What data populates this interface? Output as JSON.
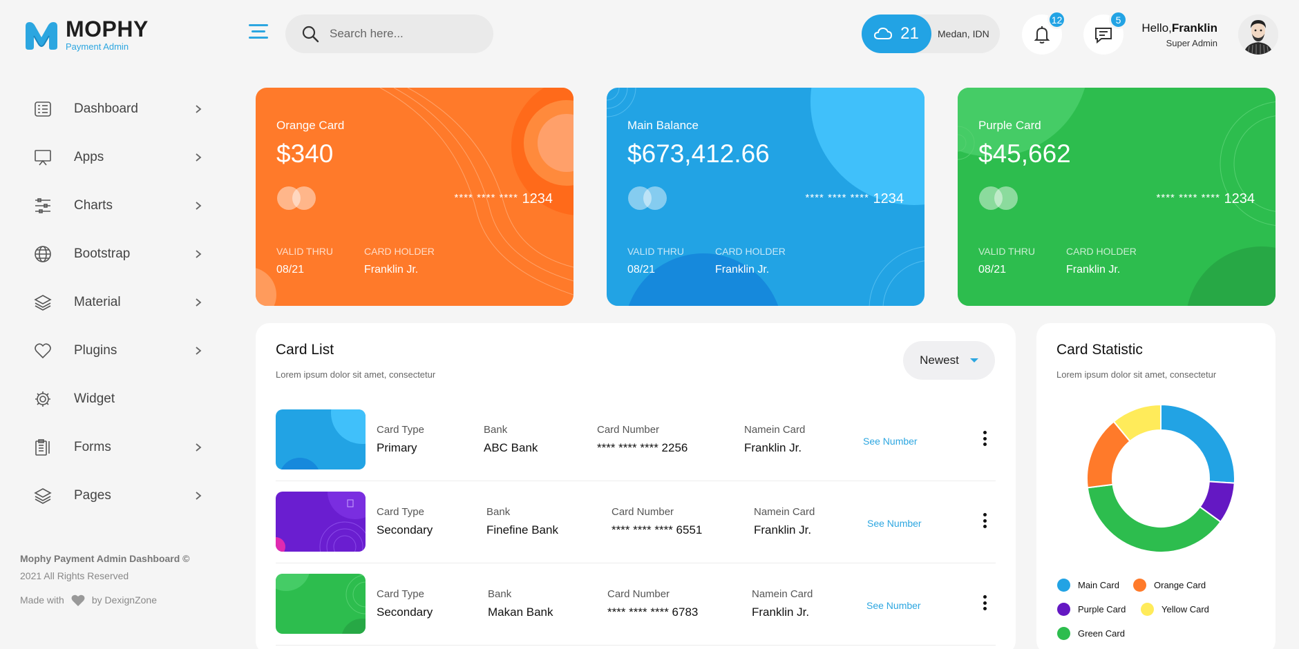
{
  "brand": {
    "title": "MOPHY",
    "subtitle": "Payment Admin",
    "accent": "#2ca6e0"
  },
  "sidebar": {
    "items": [
      {
        "label": "Dashboard",
        "icon": "dashboard-icon",
        "has_chevron": true
      },
      {
        "label": "Apps",
        "icon": "apps-icon",
        "has_chevron": true
      },
      {
        "label": "Charts",
        "icon": "charts-icon",
        "has_chevron": true
      },
      {
        "label": "Bootstrap",
        "icon": "globe-icon",
        "has_chevron": true
      },
      {
        "label": "Material",
        "icon": "layers-icon",
        "has_chevron": true
      },
      {
        "label": "Plugins",
        "icon": "heart-icon",
        "has_chevron": true
      },
      {
        "label": "Widget",
        "icon": "gear-icon",
        "has_chevron": false
      },
      {
        "label": "Forms",
        "icon": "forms-icon",
        "has_chevron": true
      },
      {
        "label": "Pages",
        "icon": "pages-icon",
        "has_chevron": true
      }
    ],
    "footer": {
      "copyright": "Mophy Payment Admin Dashboard ©",
      "rights": "2021 All Rights Reserved",
      "made_with": "Made with",
      "by": "by DexignZone"
    }
  },
  "header": {
    "search_placeholder": "Search here...",
    "weather": {
      "temp": "21",
      "location": "Medan, IDN"
    },
    "notifications_count": "12",
    "messages_count": "5",
    "user": {
      "greeting": "Hello,",
      "name": "Franklin",
      "role": "Super Admin"
    }
  },
  "cards": [
    {
      "label": "Orange Card",
      "amount": "$340",
      "stars": "**** **** ****",
      "last4": "1234",
      "valid_label": "VALID THRU",
      "valid": "08/21",
      "holder_label": "CARD HOLDER",
      "holder": "Franklin Jr.",
      "color": "#ff7a2a"
    },
    {
      "label": "Main Balance",
      "amount": "$673,412.66",
      "stars": "**** **** ****",
      "last4": "1234",
      "valid_label": "VALID THRU",
      "valid": "08/21",
      "holder_label": "CARD HOLDER",
      "holder": "Franklin Jr.",
      "color": "#22a3e4"
    },
    {
      "label": "Purple Card",
      "amount": "$45,662",
      "stars": "**** **** ****",
      "last4": "1234",
      "valid_label": "VALID THRU",
      "valid": "08/21",
      "holder_label": "CARD HOLDER",
      "holder": "Franklin Jr.",
      "color": "#2dbd4e"
    }
  ],
  "card_list": {
    "title": "Card List",
    "subtitle": "Lorem ipsum dolor sit amet, consectetur",
    "sort": "Newest",
    "column_labels": {
      "type": "Card Type",
      "bank": "Bank",
      "number": "Card Number",
      "name": "Namein Card"
    },
    "see_label": "See Number",
    "rows": [
      {
        "type": "Primary",
        "bank": "ABC Bank",
        "number": "**** **** **** 2256",
        "name": "Franklin Jr.",
        "color": "#22a3e4"
      },
      {
        "type": "Secondary",
        "bank": "Finefine Bank",
        "number": "**** **** **** 6551",
        "name": "Franklin Jr.",
        "color": "#6a1ed0"
      },
      {
        "type": "Secondary",
        "bank": "Makan Bank",
        "number": "**** **** **** 6783",
        "name": "Franklin Jr.",
        "color": "#2dbd4e"
      }
    ]
  },
  "statistic": {
    "title": "Card Statistic",
    "subtitle": "Lorem ipsum dolor sit amet, consectetur",
    "chart_data": {
      "type": "pie",
      "categories": [
        "Main Card",
        "Purple Card",
        "Green Card",
        "Orange Card",
        "Yellow Card"
      ],
      "values": [
        26,
        9,
        38,
        16,
        11
      ],
      "colors": [
        "#22a3e4",
        "#6418c3",
        "#2dbd4e",
        "#ff7a2a",
        "#ffeb5a"
      ]
    },
    "legend": [
      {
        "label": "Main Card",
        "color": "#22a3e4"
      },
      {
        "label": "Orange Card",
        "color": "#ff7a2a"
      },
      {
        "label": "Purple Card",
        "color": "#6418c3"
      },
      {
        "label": "Yellow Card",
        "color": "#ffeb5a"
      },
      {
        "label": "Green Card",
        "color": "#2dbd4e"
      }
    ]
  }
}
